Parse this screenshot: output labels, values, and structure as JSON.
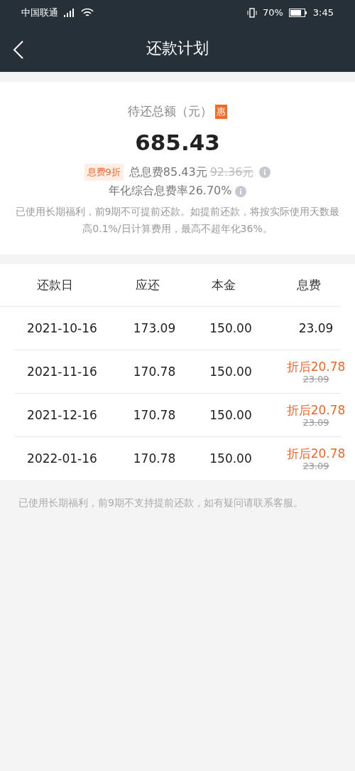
{
  "status_bar": {
    "carrier": "中国联通",
    "battery": "70%",
    "time": "3:45"
  },
  "nav": {
    "title": "还款计划"
  },
  "summary": {
    "label": "待还总额（元）",
    "badge": "惠",
    "amount": "685.43",
    "discount_tag": "息费9折",
    "total_fee": "总息费85.43元",
    "original_fee": "92.36元",
    "rate": "年化综合息费率26.70%",
    "notice": "已使用长期福利，前9期不可提前还款。如提前还款，将按实际使用天数最高0.1%/日计算费用，最高不超年化36%。"
  },
  "table": {
    "columns": [
      "还款日",
      "应还",
      "本金",
      "息费"
    ],
    "rows": [
      {
        "date": "2021-10-16",
        "due": "173.09",
        "principal": "150.00",
        "kind": "plain",
        "fee": "23.09"
      },
      {
        "date": "2021-11-16",
        "due": "170.78",
        "principal": "150.00",
        "kind": "discounted",
        "fee": "折后20.78",
        "original_fee": "23.09"
      },
      {
        "date": "2021-12-16",
        "due": "170.78",
        "principal": "150.00",
        "kind": "discounted",
        "fee": "折后20.78",
        "original_fee": "23.09"
      },
      {
        "date": "2022-01-16",
        "due": "170.78",
        "principal": "150.00",
        "kind": "discounted",
        "fee": "折后20.78",
        "original_fee": "23.09"
      }
    ]
  },
  "footer_note": "已使用长期福利，前9期不支持提前还款，如有疑问请联系客服。"
}
